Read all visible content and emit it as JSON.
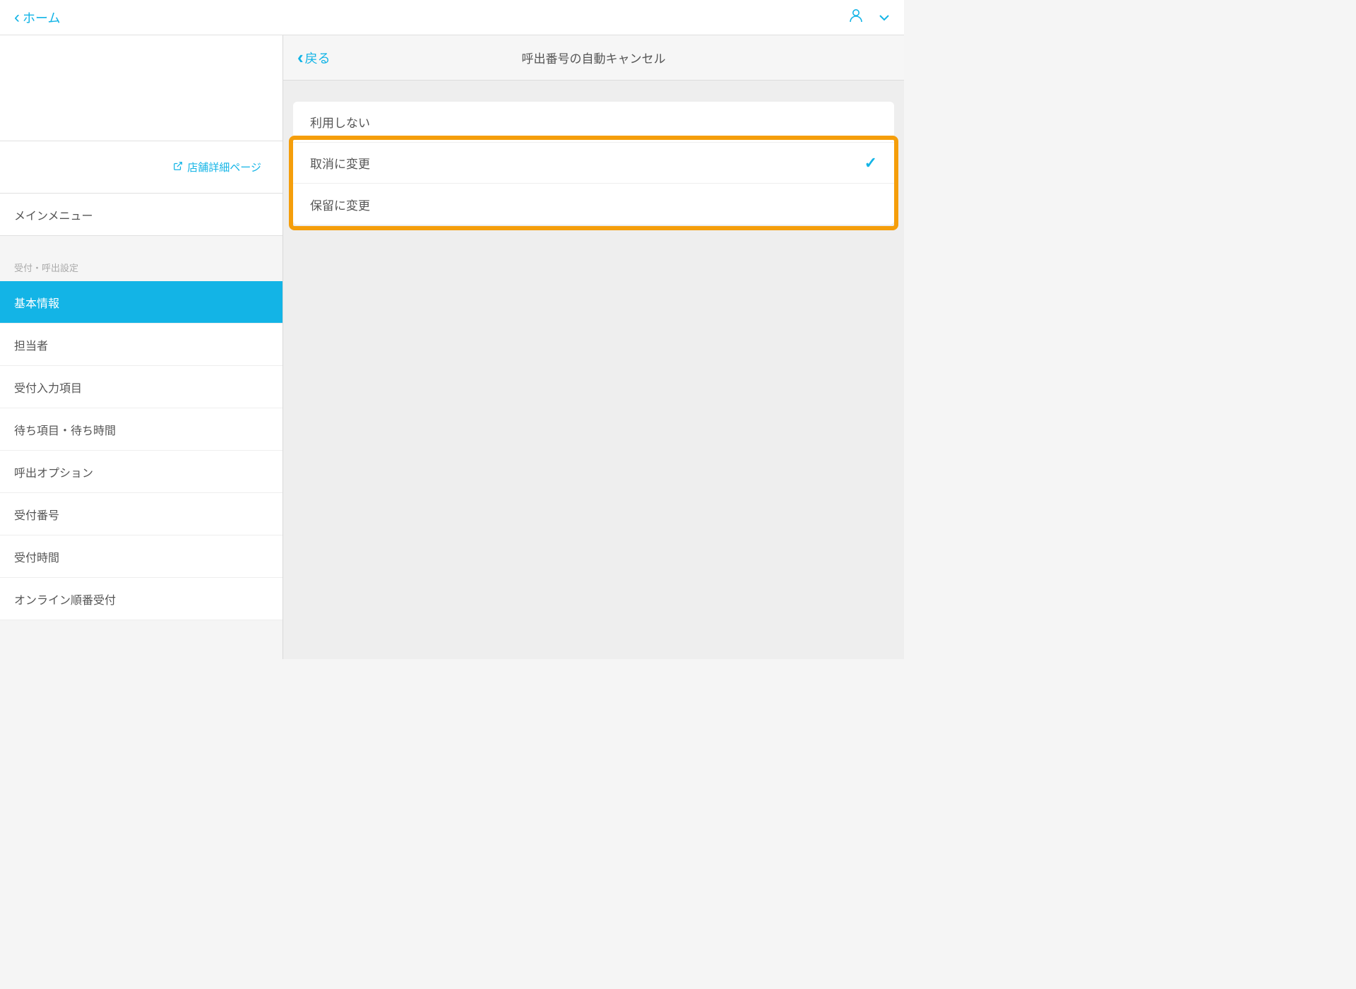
{
  "header": {
    "home_label": "ホーム"
  },
  "sidebar": {
    "store_detail_link": "店舗詳細ページ",
    "main_menu_label": "メインメニュー",
    "section_header": "受付・呼出設定",
    "items": [
      {
        "label": "基本情報",
        "active": true
      },
      {
        "label": "担当者",
        "active": false
      },
      {
        "label": "受付入力項目",
        "active": false
      },
      {
        "label": "待ち項目・待ち時間",
        "active": false
      },
      {
        "label": "呼出オプション",
        "active": false
      },
      {
        "label": "受付番号",
        "active": false
      },
      {
        "label": "受付時間",
        "active": false
      },
      {
        "label": "オンライン順番受付",
        "active": false
      }
    ]
  },
  "sub_header": {
    "back_label": "戻る",
    "title": "呼出番号の自動キャンセル"
  },
  "options": {
    "items": [
      {
        "label": "利用しない",
        "selected": false
      },
      {
        "label": "取消に変更",
        "selected": true
      },
      {
        "label": "保留に変更",
        "selected": false
      }
    ]
  }
}
